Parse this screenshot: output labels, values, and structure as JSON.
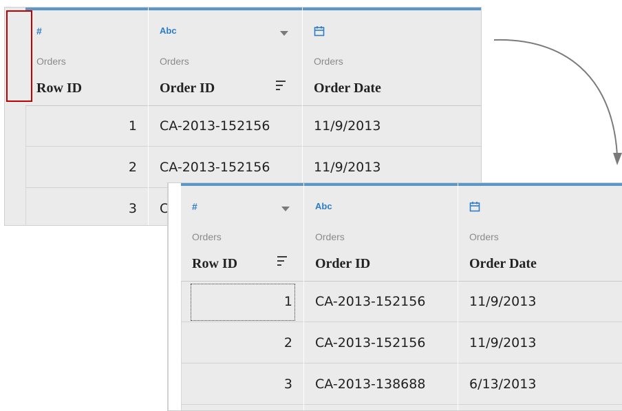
{
  "before": {
    "columns": [
      {
        "type_icon": "number-icon",
        "type_label": "#",
        "source": "Orders",
        "name": "Row ID",
        "has_dropdown": false,
        "has_sort": false
      },
      {
        "type_icon": "string-icon",
        "type_label": "Abc",
        "source": "Orders",
        "name": "Order ID",
        "has_dropdown": true,
        "has_sort": true
      },
      {
        "type_icon": "calendar-icon",
        "type_label": "",
        "source": "Orders",
        "name": "Order Date",
        "has_dropdown": false,
        "has_sort": false
      }
    ],
    "rows": [
      [
        "1",
        "CA-2013-152156",
        "11/9/2013"
      ],
      [
        "2",
        "CA-2013-152156",
        "11/9/2013"
      ],
      [
        "3",
        "C",
        ""
      ]
    ]
  },
  "after": {
    "columns": [
      {
        "type_icon": "number-icon",
        "type_label": "#",
        "source": "Orders",
        "name": "Row ID",
        "has_dropdown": true,
        "has_sort": true
      },
      {
        "type_icon": "string-icon",
        "type_label": "Abc",
        "source": "Orders",
        "name": "Order ID",
        "has_dropdown": false,
        "has_sort": false
      },
      {
        "type_icon": "calendar-icon",
        "type_label": "",
        "source": "Orders",
        "name": "Order Date",
        "has_dropdown": false,
        "has_sort": false
      }
    ],
    "rows": [
      [
        "1",
        "CA-2013-152156",
        "11/9/2013"
      ],
      [
        "2",
        "CA-2013-152156",
        "11/9/2013"
      ],
      [
        "3",
        "CA-2013-138688",
        "6/13/2013"
      ]
    ]
  },
  "colors": {
    "accent": "#5b97c6",
    "icon": "#2e7cc4",
    "highlight": "#c00000"
  }
}
